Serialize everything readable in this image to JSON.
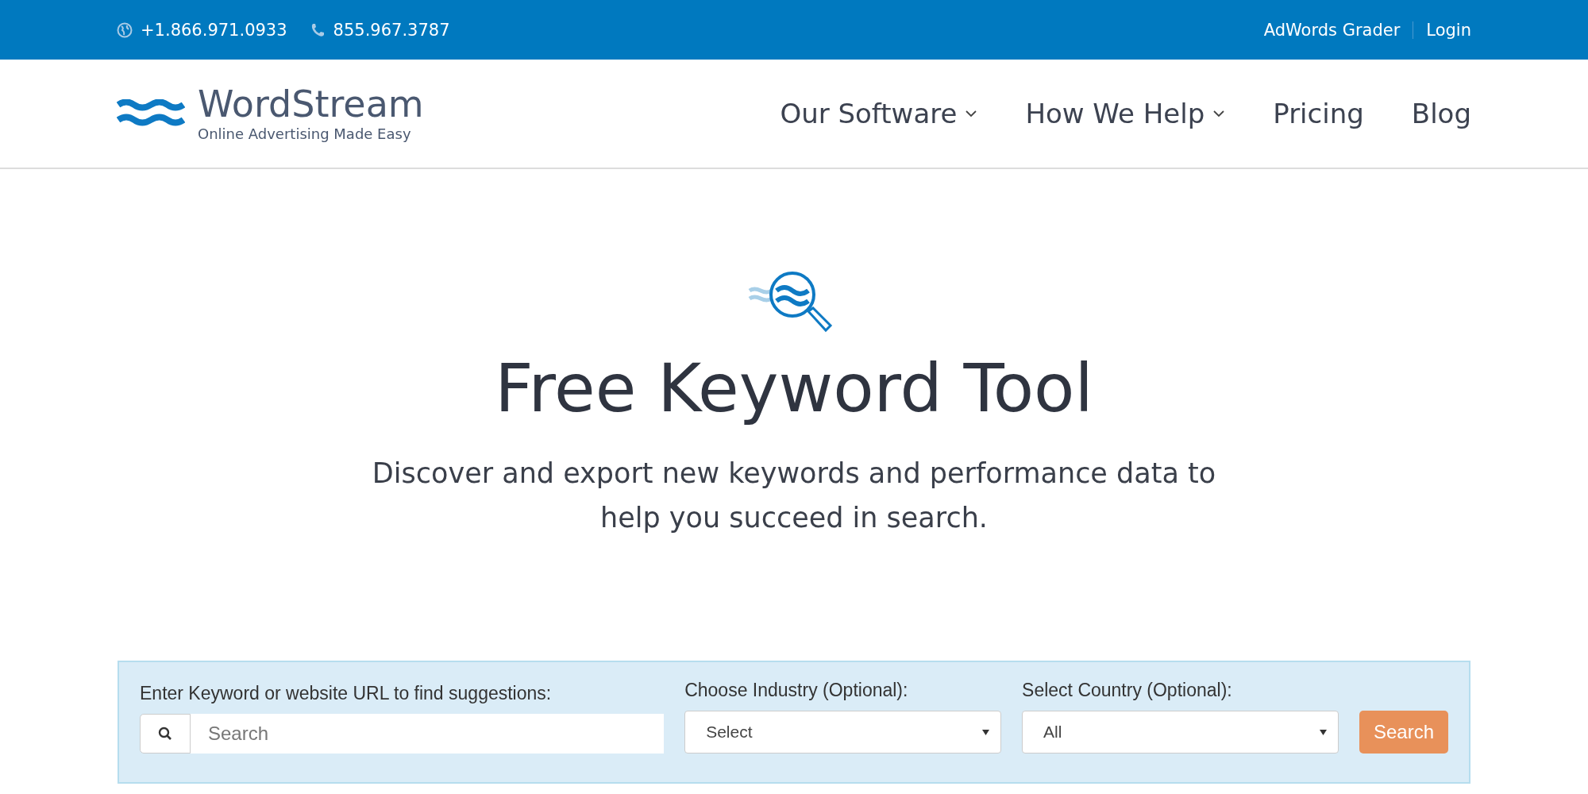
{
  "top_bar": {
    "phones": [
      {
        "kind": "globe",
        "number": "+1.866.971.0933"
      },
      {
        "kind": "phone",
        "number": "855.967.3787"
      }
    ],
    "links": [
      "AdWords Grader",
      "Login"
    ]
  },
  "header": {
    "logo": {
      "name": "WordStream",
      "tagline": "Online Advertising Made Easy"
    },
    "nav": [
      {
        "label": "Our Software",
        "has_menu": true
      },
      {
        "label": "How We Help",
        "has_menu": true
      },
      {
        "label": "Pricing",
        "has_menu": false
      },
      {
        "label": "Blog",
        "has_menu": false
      }
    ]
  },
  "hero": {
    "title": "Free Keyword Tool",
    "subtitle": "Discover and export new keywords and performance data to help you succeed in search."
  },
  "search_form": {
    "keyword": {
      "label": "Enter Keyword or website URL to find suggestions:",
      "placeholder": "Search"
    },
    "industry": {
      "label": "Choose Industry (Optional):",
      "value": "Select"
    },
    "country": {
      "label": "Select Country (Optional):",
      "value": "All"
    },
    "button": "Search"
  }
}
